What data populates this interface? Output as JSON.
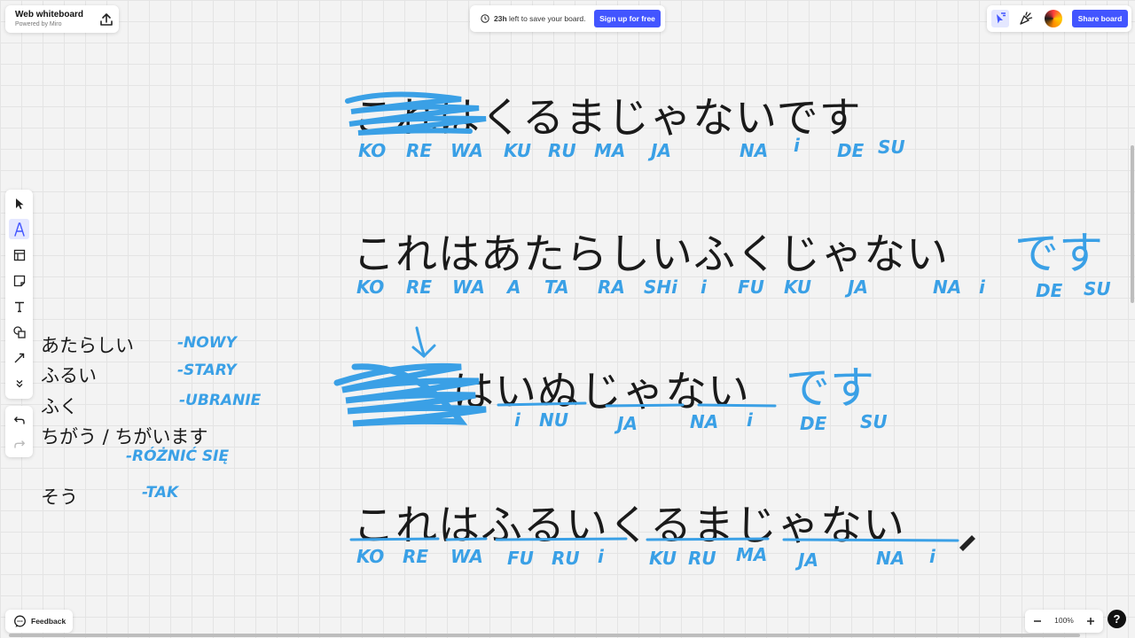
{
  "app": {
    "title": "Web whiteboard",
    "subtitle": "Powered by Miro"
  },
  "notice": {
    "hours": "23h",
    "text": "left to save your board.",
    "signup_label": "Sign up for free"
  },
  "header_right": {
    "share_label": "Share board"
  },
  "toolbar": {
    "tools": [
      "select-tool",
      "pen-tool",
      "template-tool",
      "sticky-note-tool",
      "text-tool",
      "shapes-tool",
      "line-tool",
      "more-tools"
    ]
  },
  "bottom": {
    "feedback_label": "Feedback",
    "zoom_level": "100%",
    "help_label": "?"
  },
  "board": {
    "sentence1": {
      "text": "これはくるまじゃないです",
      "romaji": [
        "KO",
        "RE",
        "WA",
        "KU",
        "RU",
        "MA",
        "JA",
        "NA",
        "i",
        "DE",
        "SU"
      ]
    },
    "sentence2": {
      "text": "これはあたらしいふくじゃない",
      "added": "です",
      "romaji": [
        "KO",
        "RE",
        "WA",
        "A",
        "TA",
        "RA",
        "SHi",
        "i",
        "FU",
        "KU",
        "JA",
        "NA",
        "i",
        "DE",
        "SU"
      ]
    },
    "sentence3": {
      "text": "はいぬじゃない",
      "added": "です",
      "romaji": [
        "i",
        "NU",
        "JA",
        "NA",
        "i",
        "DE",
        "SU"
      ]
    },
    "sentence4": {
      "text": "これはふるいくるまじゃない",
      "romaji": [
        "KO",
        "RE",
        "WA",
        "FU",
        "RU",
        "i",
        "KU",
        "RU",
        "MA",
        "JA",
        "NA",
        "i"
      ]
    },
    "vocab": [
      {
        "jp": "あたらしい",
        "pl": "-NOWY"
      },
      {
        "jp": "ふるい",
        "pl": "-STARY"
      },
      {
        "jp": "ふく",
        "pl": "-UBRANIE"
      },
      {
        "jp": "ちがう / ちがいます",
        "pl": "-RÓŻNIĆ SIĘ"
      },
      {
        "jp": "そう",
        "pl": "-TAK"
      }
    ]
  },
  "colors": {
    "accent": "#4255ff",
    "ink_blue": "#3aa0e6"
  }
}
